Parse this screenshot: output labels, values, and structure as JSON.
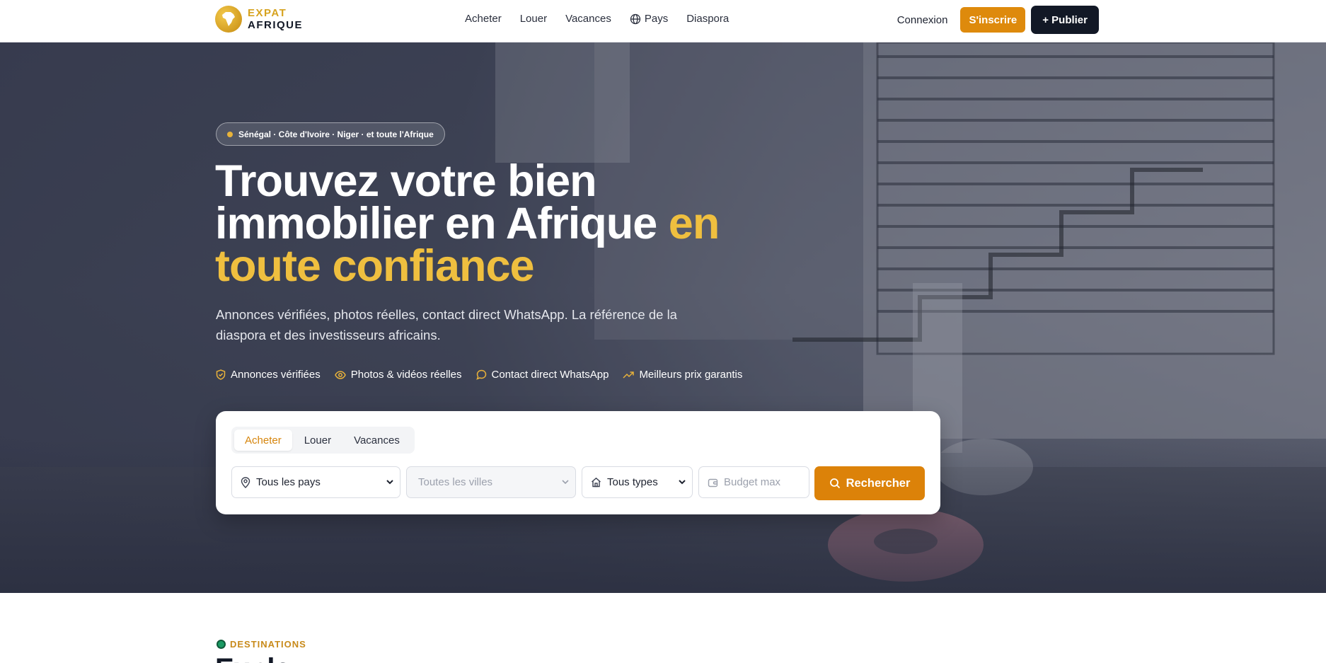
{
  "header": {
    "logo": {
      "line1": "EXPAT",
      "line2": "AFRIQUE"
    },
    "nav": [
      {
        "label": "Acheter"
      },
      {
        "label": "Louer"
      },
      {
        "label": "Vacances"
      },
      {
        "label": "Pays",
        "icon": "globe-icon"
      },
      {
        "label": "Diaspora"
      }
    ],
    "login_label": "Connexion",
    "signup_label": "S'inscrire",
    "publish_label": "+ Publier"
  },
  "hero": {
    "badge": "Sénégal · Côte d'Ivoire · Niger · et toute l'Afrique",
    "headline_white": "Trouvez votre bien immobilier en Afrique",
    "headline_gold": "en toute confiance",
    "subtitle": "Annonces vérifiées, photos réelles, contact direct WhatsApp. La référence de la diaspora et des investisseurs africains.",
    "features": [
      {
        "label": "Annonces vérifiées",
        "icon": "shield-check-icon"
      },
      {
        "label": "Photos & vidéos réelles",
        "icon": "eye-icon"
      },
      {
        "label": "Contact direct WhatsApp",
        "icon": "chat-bubble-icon"
      },
      {
        "label": "Meilleurs prix garantis",
        "icon": "trending-up-icon"
      }
    ]
  },
  "search": {
    "tabs": [
      {
        "label": "Acheter",
        "active": true
      },
      {
        "label": "Louer",
        "active": false
      },
      {
        "label": "Vacances",
        "active": false
      }
    ],
    "country_value": "Tous les pays",
    "city_placeholder": "Toutes les villes",
    "type_value": "Tous types",
    "budget_placeholder": "Budget max",
    "button_label": "Rechercher"
  },
  "destinations": {
    "label": "DESTINATIONS",
    "heading": "Exple"
  },
  "colors": {
    "accent": "#de8a0c",
    "gold": "#efbf3f",
    "dark": "#121826"
  }
}
